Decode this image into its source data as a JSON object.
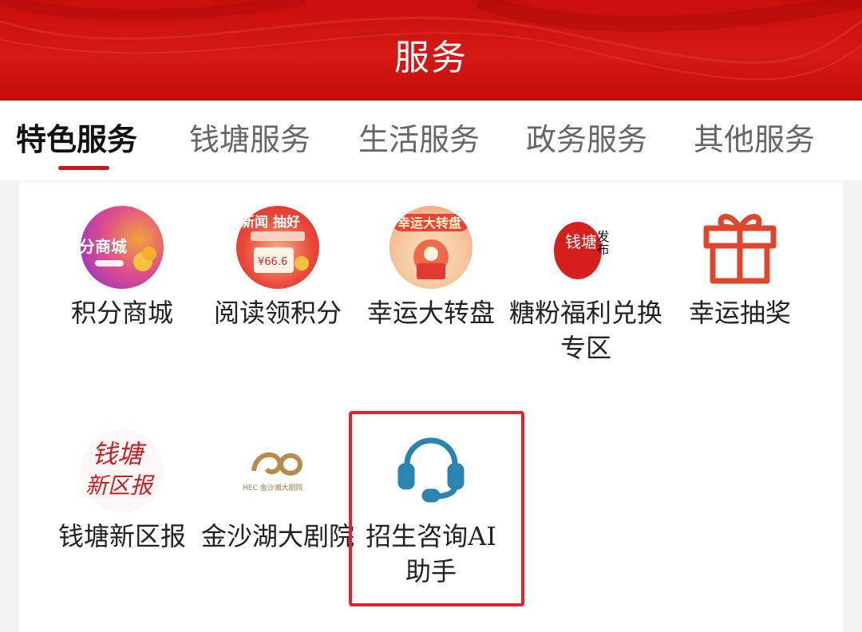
{
  "header": {
    "title": "服务"
  },
  "tabs": [
    {
      "label": "特色服务",
      "active": true
    },
    {
      "label": "钱塘服务",
      "active": false
    },
    {
      "label": "生活服务",
      "active": false
    },
    {
      "label": "政务服务",
      "active": false
    },
    {
      "label": "其他服务",
      "active": false
    }
  ],
  "services": [
    {
      "label": "积分商城",
      "icon_text": "分商城",
      "icon": "points-mall-icon"
    },
    {
      "label": "阅读领积分",
      "icon_text": "新闻 抽好",
      "icon_subtext": "¥66.6",
      "icon": "read-points-icon"
    },
    {
      "label": "幸运大转盘",
      "icon_text": "幸运大转盘",
      "icon": "lucky-wheel-icon"
    },
    {
      "label": "糖粉福利兑换专区",
      "icon_text": "钱塘",
      "icon_subtext": "发布",
      "icon": "welfare-exchange-icon"
    },
    {
      "label": "幸运抽奖",
      "icon": "gift-box-icon"
    },
    {
      "label": "钱塘新区报",
      "icon_text": "钱塘",
      "icon_subtext": "新区报",
      "icon": "qiantang-newspaper-icon"
    },
    {
      "label": "金沙湖大剧院",
      "icon_text": "HEC 金沙湖大剧院",
      "icon": "theater-logo-icon"
    },
    {
      "label": "招生咨询AI助手",
      "icon": "headset-icon",
      "highlighted": true
    }
  ],
  "colors": {
    "brand_red": "#c8161d",
    "highlight_border": "#e0242a",
    "headset_blue": "#2a84b0"
  }
}
